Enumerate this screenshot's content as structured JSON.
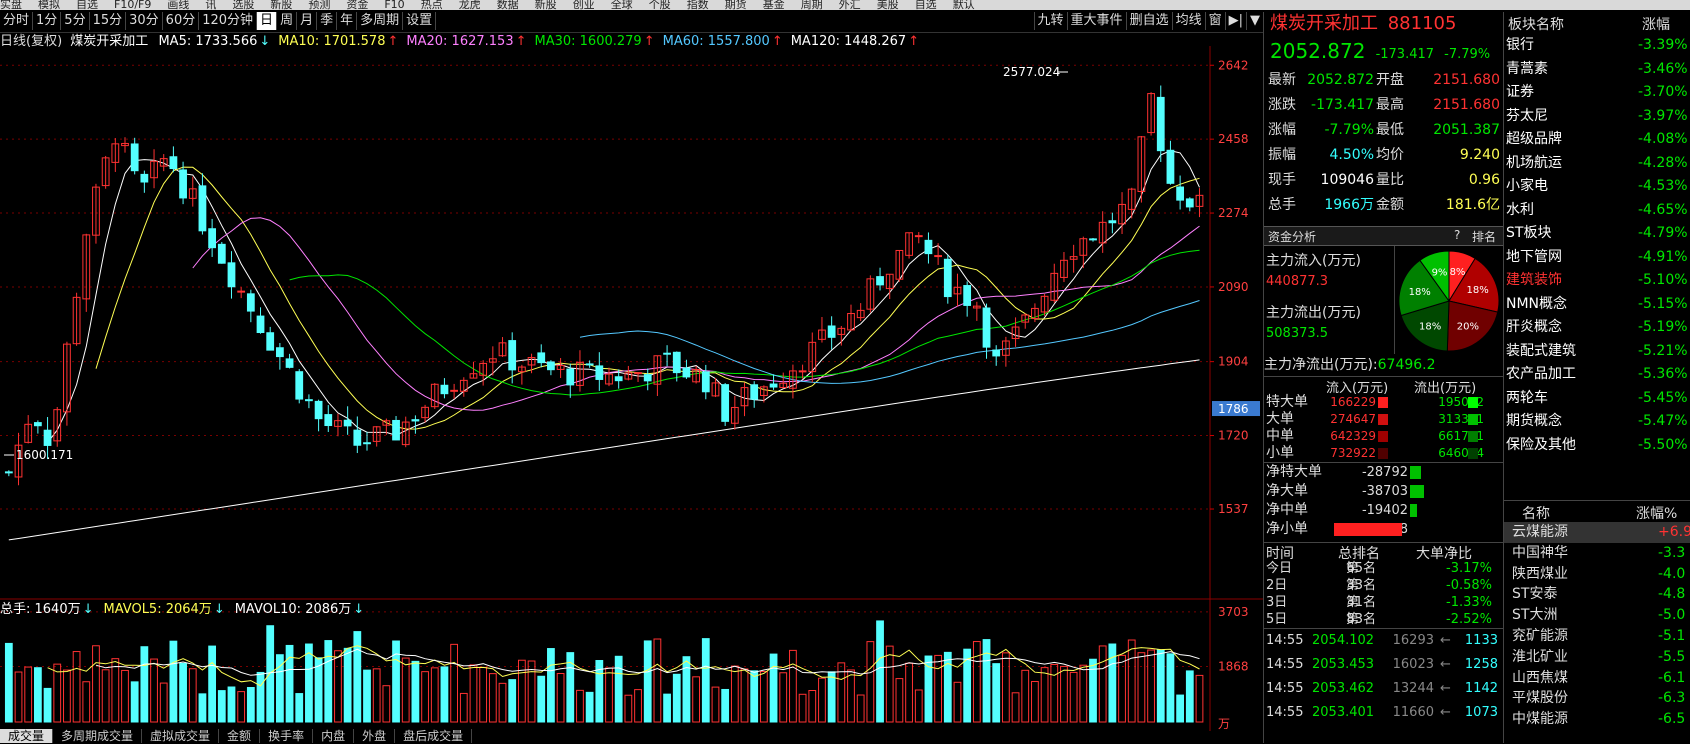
{
  "top_menu": [
    "实盘",
    "模拟",
    "自选",
    "F10/F9",
    "画线",
    "讯",
    "选股",
    "新股",
    "预测",
    "资金",
    "F10",
    "热点",
    "龙虎",
    "数据",
    "新股",
    "创业",
    "全球",
    "个股",
    "指数",
    "期货",
    "基金",
    "周期",
    "外汇",
    "美股",
    "自选",
    "默认"
  ],
  "period_tabs": [
    "分时",
    "1分",
    "5分",
    "15分",
    "30分",
    "60分",
    "120分钟",
    "日",
    "周",
    "月",
    "季",
    "年",
    "多周期",
    "设置"
  ],
  "period_active": "日",
  "right_tabs": [
    "九转",
    "重大事件",
    "删自选",
    "均线",
    "窗",
    "▶|",
    "▼"
  ],
  "legend": {
    "prefix": "日线(复权)",
    "name": "煤炭开采加工",
    "items": [
      {
        "text": "MA5: 1733.566",
        "arrow": "↓",
        "color": "#ffffff"
      },
      {
        "text": "MA10: 1701.578",
        "arrow": "↑",
        "color": "#ffff54"
      },
      {
        "text": "MA20: 1627.153",
        "arrow": "↑",
        "color": "#ff80ff"
      },
      {
        "text": "MA30: 1600.279",
        "arrow": "↑",
        "color": "#00e600"
      },
      {
        "text": "MA60: 1557.800",
        "arrow": "↑",
        "color": "#54c8ff"
      },
      {
        "text": "MA120: 1448.267",
        "arrow": "↑",
        "color": "#ffffff"
      }
    ]
  },
  "vol_legend": [
    {
      "text": "总手: 1640万",
      "arrow": "↓",
      "color": "#ffffff"
    },
    {
      "text": "MAVOL5: 2064万",
      "arrow": "↓",
      "color": "#ffff54"
    },
    {
      "text": "MAVOL10: 2086万",
      "arrow": "↓",
      "color": "#ffffff"
    }
  ],
  "bottom_tabs": [
    "成交量",
    "多周期成交量",
    "虚拟成交量",
    "金额",
    "换手率",
    "内盘",
    "外盘",
    "盘后成交量"
  ],
  "colors": {
    "up": "#ff3232",
    "down": "#54ffff",
    "ma5": "#ffffff",
    "ma10": "#ffff54",
    "ma20": "#ff80ff",
    "ma30": "#00e600",
    "ma60": "#54c8ff",
    "ma120": "#ffffff",
    "grid": "#7a0000"
  },
  "chart_data": {
    "type": "candlestick",
    "price_axis_ticks": [
      "2642",
      "2458",
      "2274",
      "2090",
      "1904",
      "1720",
      "1537"
    ],
    "price_axis_values": [
      2642,
      2458,
      2274,
      2090,
      1904,
      1720,
      1537
    ],
    "price_axis_range": [
      1425,
      2680
    ],
    "current_price_tag": "1786",
    "high_annotation": "2577.024",
    "low_annotation": "1600.171",
    "volume_axis_ticks": [
      "3703",
      "1868"
    ],
    "volume_axis_values": [
      3703,
      1868
    ],
    "volume_unit": "万",
    "volume_axis_range": [
      0,
      3900
    ]
  },
  "quote": {
    "name": "煤炭开采加工",
    "code": "881105",
    "price": "2052.872",
    "change": "-173.417",
    "change_pct": "-7.79%",
    "rows": [
      {
        "l1": "最新",
        "v1": "2052.872",
        "l2": "开盘",
        "v2": "2151.680",
        "c1": "dn",
        "c2": "up"
      },
      {
        "l1": "涨跌",
        "v1": "-173.417",
        "l2": "最高",
        "v2": "2151.680",
        "c1": "dn",
        "c2": "up"
      },
      {
        "l1": "涨幅",
        "v1": "-7.79%",
        "l2": "最低",
        "v2": "2051.387",
        "c1": "dn",
        "c2": "dn"
      },
      {
        "l1": "振幅",
        "v1": "4.50%",
        "l2": "均价",
        "v2": "9.240",
        "c1": "cy",
        "c2": "yl"
      },
      {
        "l1": "现手",
        "v1": "109046",
        "l2": "量比",
        "v2": "0.96",
        "c1": "wh",
        "c2": "yl"
      },
      {
        "l1": "总手",
        "v1": "1966万",
        "l2": "金额",
        "v2": "181.6亿",
        "c1": "cy",
        "c2": "yl"
      }
    ]
  },
  "fund": {
    "header": "资金分析",
    "q": "?",
    "rank": "排名",
    "inflow_label": "主力流入(万元)",
    "inflow": "440877.3",
    "outflow_label": "主力流出(万元)",
    "outflow": "508373.5",
    "net_label": "主力净流出(万元):",
    "net": "67496.2",
    "pie": [
      {
        "pct": "8%",
        "value": 8,
        "color": "#ff2020"
      },
      {
        "pct": "18%",
        "value": 18,
        "color": "#b00000"
      },
      {
        "pct": "20%",
        "value": 20,
        "color": "#700000"
      },
      {
        "pct": "18%",
        "value": 18,
        "color": "#004800"
      },
      {
        "pct": "18%",
        "value": 18,
        "color": "#008000"
      },
      {
        "pct": "9%",
        "value": 9,
        "color": "#00c000"
      }
    ],
    "col_in": "流入(万元)",
    "col_out": "流出(万元)",
    "rows": [
      {
        "label": "特大单",
        "in": "166229",
        "out": "195022",
        "inc": "#ff2020",
        "outc": "#00ff00"
      },
      {
        "label": "大单",
        "in": "274647",
        "out": "313351",
        "inc": "#d01010",
        "outc": "#00c000"
      },
      {
        "label": "中单",
        "in": "642329",
        "out": "661731",
        "inc": "#a00000",
        "outc": "#008000"
      },
      {
        "label": "小单",
        "in": "732922",
        "out": "646024",
        "inc": "#500000",
        "outc": "#004000"
      }
    ],
    "net_rows": [
      {
        "label": "净特大单",
        "value": "-28792",
        "color": "#00c000",
        "w": 0.3
      },
      {
        "label": "净大单",
        "value": "-38703",
        "color": "#00c000",
        "w": 0.4
      },
      {
        "label": "净中单",
        "value": "-19402",
        "color": "#00c000",
        "w": 0.2
      },
      {
        "label": "净小单",
        "value": "86898",
        "color": "#ff2020",
        "w": 0.9
      }
    ],
    "rank_head": {
      "time": "时间",
      "rank": "总排名",
      "net": "大单净比"
    },
    "rank_rows": [
      {
        "t": "今日",
        "p": "第",
        "n": "65名",
        "v": "-3.17%"
      },
      {
        "t": "2日",
        "p": "第",
        "n": "33名",
        "v": "-0.58%"
      },
      {
        "t": "3日",
        "p": "第",
        "n": "31名",
        "v": "-1.33%"
      },
      {
        "t": "5日",
        "p": "第",
        "n": "83名",
        "v": "-2.52%"
      }
    ],
    "ticks": [
      {
        "time": "14:55",
        "price": "2054.102",
        "vol": "16293",
        "arrow": "←",
        "amt": "1133"
      },
      {
        "time": "14:55",
        "price": "2053.453",
        "vol": "16023",
        "arrow": "←",
        "amt": "1258"
      },
      {
        "time": "14:55",
        "price": "2053.462",
        "vol": "13244",
        "arrow": "←",
        "amt": "1142"
      },
      {
        "time": "14:55",
        "price": "2053.401",
        "vol": "11660",
        "arrow": "←",
        "amt": "1073"
      }
    ]
  },
  "sectors": {
    "head_name": "板块名称",
    "head_chg": "涨幅",
    "rows": [
      {
        "name": "银行",
        "chg": "-3.39%",
        "nc": "#ffffff"
      },
      {
        "name": "青蒿素",
        "chg": "-3.46%",
        "nc": "#ffffff"
      },
      {
        "name": "证券",
        "chg": "-3.70%",
        "nc": "#ffffff"
      },
      {
        "name": "芬太尼",
        "chg": "-3.97%",
        "nc": "#ffffff"
      },
      {
        "name": "超级品牌",
        "chg": "-4.08%",
        "nc": "#ffffff"
      },
      {
        "name": "机场航运",
        "chg": "-4.28%",
        "nc": "#ffffff"
      },
      {
        "name": "小家电",
        "chg": "-4.53%",
        "nc": "#ffffff"
      },
      {
        "name": "水利",
        "chg": "-4.65%",
        "nc": "#ffffff"
      },
      {
        "name": "ST板块",
        "chg": "-4.79%",
        "nc": "#ffffff"
      },
      {
        "name": "地下管网",
        "chg": "-4.91%",
        "nc": "#ffffff"
      },
      {
        "name": "建筑装饰",
        "chg": "-5.10%",
        "nc": "#ff3232"
      },
      {
        "name": "NMN概念",
        "chg": "-5.15%",
        "nc": "#ffffff"
      },
      {
        "name": "肝炎概念",
        "chg": "-5.19%",
        "nc": "#ffffff"
      },
      {
        "name": "装配式建筑",
        "chg": "-5.21%",
        "nc": "#ffffff"
      },
      {
        "name": "农产品加工",
        "chg": "-5.36%",
        "nc": "#ffffff"
      },
      {
        "name": "两轮车",
        "chg": "-5.45%",
        "nc": "#ffffff"
      },
      {
        "name": "期货概念",
        "chg": "-5.47%",
        "nc": "#ffffff"
      },
      {
        "name": "保险及其他",
        "chg": "-5.50%",
        "nc": "#ffffff"
      }
    ]
  },
  "stocks": {
    "head_name": "名称",
    "head_chg": "涨幅%",
    "rows": [
      {
        "name": "云煤能源",
        "chg": "+6.9",
        "cc": "#ff3232",
        "hl": true
      },
      {
        "name": "中国神华",
        "chg": "-3.3",
        "cc": "#00e600",
        "hl": false
      },
      {
        "name": "陕西煤业",
        "chg": "-4.0",
        "cc": "#00e600",
        "hl": false
      },
      {
        "name": "ST安泰",
        "chg": "-4.8",
        "cc": "#00e600",
        "hl": false
      },
      {
        "name": "ST大洲",
        "chg": "-5.0",
        "cc": "#00e600",
        "hl": false
      },
      {
        "name": "兖矿能源",
        "chg": "-5.1",
        "cc": "#00e600",
        "hl": false
      },
      {
        "name": "淮北矿业",
        "chg": "-5.5",
        "cc": "#00e600",
        "hl": false
      },
      {
        "name": "山西焦煤",
        "chg": "-6.1",
        "cc": "#00e600",
        "hl": false
      },
      {
        "name": "平煤股份",
        "chg": "-6.3",
        "cc": "#00e600",
        "hl": false
      },
      {
        "name": "中煤能源",
        "chg": "-6.5",
        "cc": "#00e600",
        "hl": false
      }
    ]
  }
}
